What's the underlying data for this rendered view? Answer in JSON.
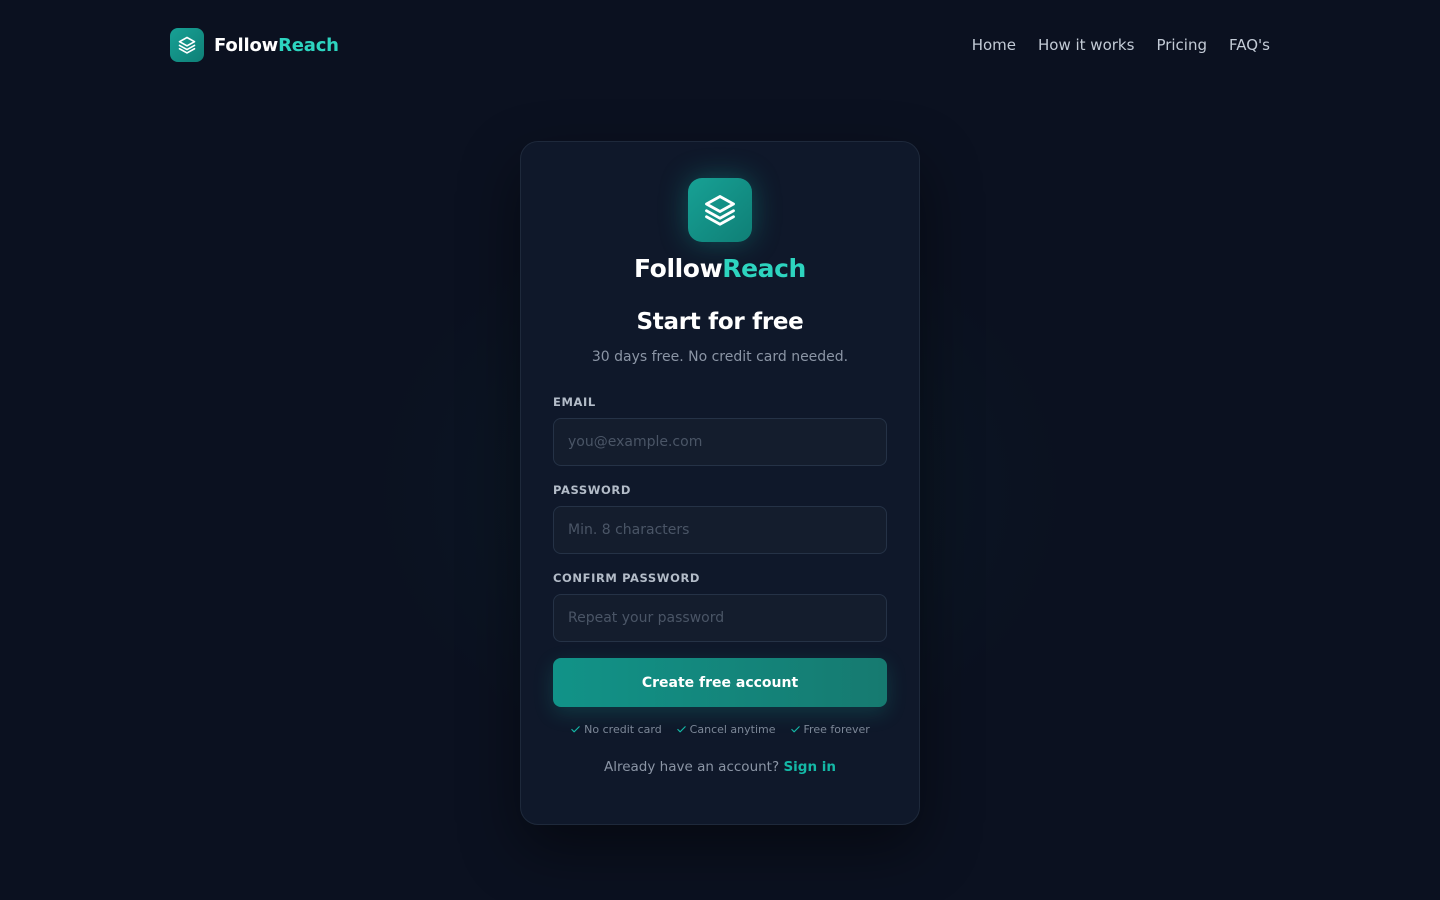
{
  "nav": {
    "brand": {
      "name_part1": "Follow",
      "name_part2": "Reach",
      "icon": "layers-icon"
    },
    "links": [
      "Home",
      "How it works",
      "Pricing",
      "FAQ's"
    ]
  },
  "card": {
    "brand": {
      "name_part1": "Follow",
      "name_part2": "Reach",
      "icon": "layers-icon"
    },
    "title": "Start for free",
    "subtitle": "30 days free. No credit card needed.",
    "fields": {
      "email": {
        "label": "EMAIL",
        "placeholder": "you@example.com",
        "value": ""
      },
      "password": {
        "label": "PASSWORD",
        "placeholder": "Min. 8 characters",
        "value": ""
      },
      "confirm": {
        "label": "CONFIRM PASSWORD",
        "placeholder": "Repeat your password",
        "value": ""
      }
    },
    "submit_label": "Create free account",
    "perks": [
      "No credit card",
      "Cancel anytime",
      "Free forever"
    ],
    "signin": {
      "prompt": "Already have an account?",
      "link": "Sign in"
    }
  },
  "colors": {
    "background": "#0b1120",
    "card": "#0f182a",
    "accent": "#14b8a6",
    "brand_accent": "#2dd4bf",
    "button": "#119388"
  }
}
